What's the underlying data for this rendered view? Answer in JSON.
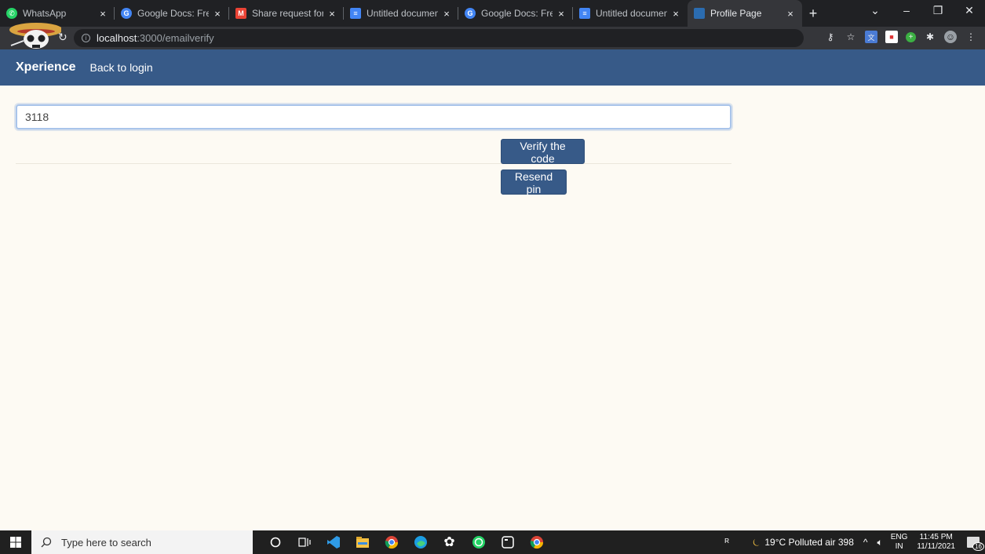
{
  "browser": {
    "tabs": [
      {
        "title": "WhatsApp",
        "favicon": "whatsapp-icon",
        "color": "#25d366"
      },
      {
        "title": "Google Docs: Free Onl",
        "favicon": "google-icon",
        "color": "#4285f4"
      },
      {
        "title": "Share request for \"Un",
        "favicon": "gmail-icon",
        "color": "#ea4335"
      },
      {
        "title": "Untitled document - G",
        "favicon": "docs-icon",
        "color": "#4285f4"
      },
      {
        "title": "Google Docs: Free Onl",
        "favicon": "google-icon",
        "color": "#4285f4"
      },
      {
        "title": "Untitled document - G",
        "favicon": "docs-icon",
        "color": "#4285f4"
      },
      {
        "title": "Profile Page",
        "favicon": "react-icon",
        "color": "#2b6cb0"
      }
    ],
    "active_tab": 6,
    "url_host": "localhost",
    "url_path": ":3000/emailverify"
  },
  "navbar": {
    "brand": "Xperience",
    "link": "Back to login"
  },
  "form": {
    "code_value": "3118",
    "verify_label": "Verify the code",
    "resend_label": "Resend pin"
  },
  "taskbar": {
    "search_placeholder": "Type here to search",
    "weather": "19°C  Polluted air 398",
    "lang_line1": "ENG",
    "lang_line2": "IN",
    "time": "11:45 PM",
    "date": "11/11/2021",
    "notifications": "16"
  },
  "colors": {
    "navbar": "#375a88",
    "page_bg": "#fdfaf3",
    "button": "#375a88"
  }
}
